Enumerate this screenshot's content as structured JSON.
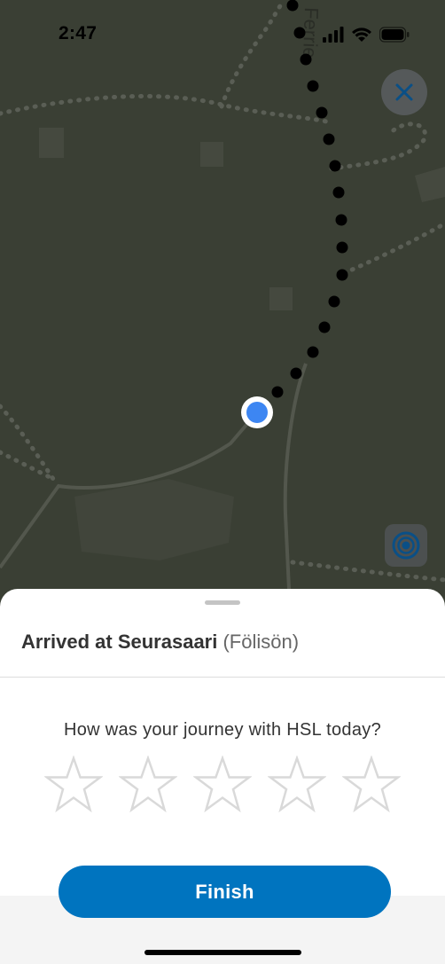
{
  "status_bar": {
    "time": "2:47",
    "icons": [
      "signal-icon",
      "wifi-icon",
      "battery-icon"
    ]
  },
  "map": {
    "street_label": "Ferrie",
    "current_location_icon": "user-location-dot",
    "colors": {
      "map_background": "#3a3f34",
      "route_dots": "#000000",
      "location_dot": "#3d86f2"
    }
  },
  "controls": {
    "close_icon": "close-icon",
    "locate_icon": "locate-icon"
  },
  "sheet": {
    "arrived_prefix": "Arrived at ",
    "stop_name": "Seurasaari",
    "stop_alt": "(Fölisön)",
    "question": "How was your journey with HSL today?",
    "rating": {
      "max": 5,
      "selected": 0,
      "icon": "star-outline-icon"
    },
    "finish_label": "Finish",
    "accent_color": "#0074bf"
  }
}
